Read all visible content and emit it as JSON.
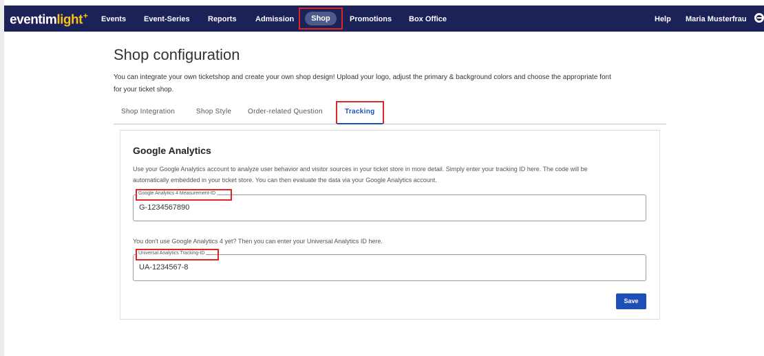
{
  "app": {
    "logo_main": "eventim",
    "logo_accent": "light",
    "logo_star": "+"
  },
  "nav": {
    "items": [
      "Events",
      "Event-Series",
      "Reports",
      "Admission",
      "Shop",
      "Promotions",
      "Box Office"
    ],
    "active": "Shop",
    "help": "Help",
    "user": "Maria Musterfrau",
    "user_icon": "user-circle-icon"
  },
  "page": {
    "title": "Shop configuration",
    "intro_line1": "You can integrate your own ticketshop and create your own shop design! Upload your logo, adjust the primary & background colors and choose the appropriate font",
    "intro_line2": "for your ticket shop."
  },
  "tabs": [
    {
      "label": "Shop Integration"
    },
    {
      "label": "Shop Style"
    },
    {
      "label": "Order-related Question"
    },
    {
      "label": "Tracking"
    }
  ],
  "active_tab": "Tracking",
  "google_analytics": {
    "title": "Google Analytics",
    "desc_line1": "Use your Google Analytics account to analyze user behavior and visitor sources in your ticket store in more detail. Simply enter your tracking ID here. The code will be",
    "desc_line2": "automatically embedded in your ticket store. You can then evaluate the data via your Google Analytics account.",
    "ga4_label": "Google Analytics 4 Measurement-ID",
    "ga4_value": "G-1234567890",
    "ua_prompt": "You don't use Google Analytics 4 yet? Then you can enter your Universal Analytics ID here.",
    "ua_label": "Universal Analytics Tracking-ID",
    "ua_value": "UA-1234567-8",
    "save_label": "Save"
  },
  "colors": {
    "navbar": "#1c2157",
    "accent": "#1e4fb8",
    "highlight": "#e02424",
    "logo_yellow": "#f4c21a"
  }
}
